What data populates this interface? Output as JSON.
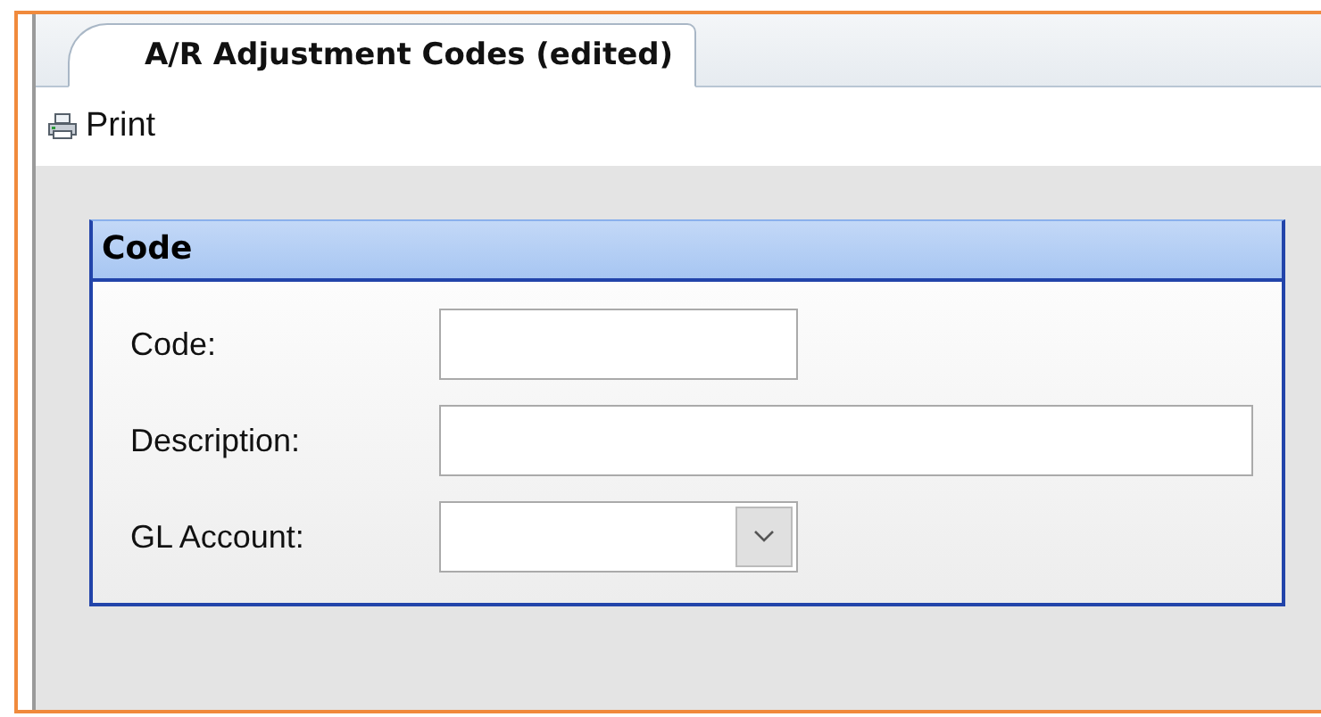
{
  "tabs": [
    {
      "label": "A/R Adjustment Codes (edited)",
      "selected": true
    }
  ],
  "toolbar": {
    "print_label": "Print"
  },
  "panel": {
    "title": "Code",
    "fields": [
      {
        "label": "Code:",
        "kind": "text",
        "wide": false
      },
      {
        "label": "Description:",
        "kind": "text",
        "wide": true
      },
      {
        "label": "GL Account:",
        "kind": "dropdown",
        "wide": false
      }
    ]
  }
}
